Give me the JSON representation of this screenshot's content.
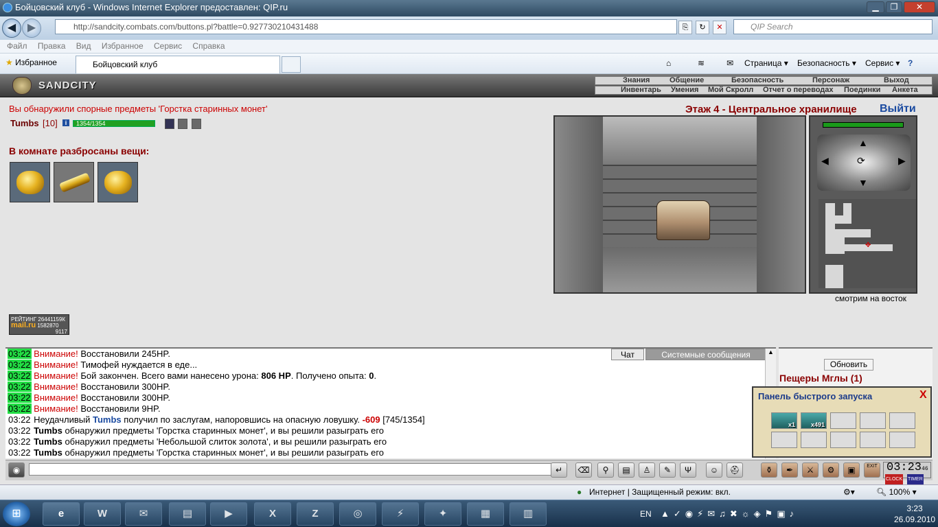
{
  "window": {
    "title": "Бойцовский клуб - Windows Internet Explorer предоставлен: QIP.ru",
    "minimize": "▁",
    "maximize": "❐",
    "close": "✕"
  },
  "address": {
    "url": "http://sandcity.combats.com/buttons.pl?battle=0.927730210431488",
    "search_placeholder": "QIP Search"
  },
  "menu": [
    "Файл",
    "Правка",
    "Вид",
    "Избранное",
    "Сервис",
    "Справка"
  ],
  "favorites": {
    "label": "Избранное",
    "tab_title": "Бойцовский клуб",
    "commands": [
      "Страница ▾",
      "Безопасность ▾",
      "Сервис ▾"
    ]
  },
  "game": {
    "logo": "SANDCITY",
    "top_links": [
      "Знания",
      "Общение",
      "Безопасность",
      "Персонаж",
      "Выход"
    ],
    "sub_links": [
      "Инвентарь",
      "Умения",
      "Мой Скролл",
      "Отчет о переводах",
      "Поединки",
      "Анкета"
    ],
    "notice": "Вы обнаружили спорные предметы 'Горстка старинных монет'",
    "player": {
      "name": "Tumbs",
      "level": "[10]",
      "info": "i",
      "hp_text": "1354/1354",
      "hp_fraction": 1.0
    },
    "room_title": "В комнате разбросаны вещи:",
    "floor_title": "Этаж 4 - Центральное хранилище",
    "exit": "Выйти",
    "facing": "смотрим на восток",
    "rating": {
      "label": "РЕЙТИНГ",
      "value1": "26441159К",
      "mail": "mail.ru",
      "value2": "1582870",
      "value3": "9117"
    }
  },
  "chat": {
    "tabs": [
      "Чат",
      "Системные сообщения"
    ],
    "lines": [
      {
        "time": "03:22",
        "hl": true,
        "warn": "Внимание!",
        "text": "Восстановили 245HP."
      },
      {
        "time": "03:22",
        "hl": true,
        "warn": "Внимание!",
        "text": "Тимофей нуждается в еде..."
      },
      {
        "time": "03:22",
        "hl": true,
        "warn": "Внимание!",
        "text": "Бой закончен. Всего вами нанесено урона:",
        "b1": "806 HP",
        "text2": ". Получено опыта:",
        "b2": "0",
        "text3": "."
      },
      {
        "time": "03:22",
        "hl": true,
        "warn": "Внимание!",
        "text": "Восстановили 300HP."
      },
      {
        "time": "03:22",
        "hl": true,
        "warn": "Внимание!",
        "text": "Восстановили 300HP."
      },
      {
        "time": "03:22",
        "hl": true,
        "warn": "Внимание!",
        "text": "Восстановили 9HP."
      },
      {
        "time": "03:22",
        "hl": false,
        "pre": "Неудачливый",
        "who": "Tumbs",
        "text": "получил по заслугам, напоровшись на опасную ловушку.",
        "dmg": "-609",
        "text2": "[745/1354]"
      },
      {
        "time": "03:22",
        "hl": false,
        "b1": "Tumbs",
        "text": "обнаружил предметы 'Горстка старинных монет', и вы решили разыграть его"
      },
      {
        "time": "03:22",
        "hl": false,
        "b1": "Tumbs",
        "text": "обнаружил предметы 'Небольшой слиток золота', и вы решили разыграть его"
      },
      {
        "time": "03:22",
        "hl": false,
        "b1": "Tumbs",
        "text": "обнаружил предметы 'Горстка старинных монет', и вы решили разыграть его"
      }
    ]
  },
  "right": {
    "refresh": "Обновить",
    "location": "Пещеры Мглы (1)"
  },
  "quick_panel": {
    "title": "Панель быстрого запуска",
    "close": "X",
    "slots": [
      "x1",
      "x491",
      "",
      "",
      "",
      "",
      "",
      "",
      "",
      ""
    ]
  },
  "game_clock": {
    "time": "03:23",
    "seconds": "46",
    "clock_label": "CLOCK",
    "timer_label": "TIMER",
    "exit_label": "EXIT"
  },
  "status": {
    "zone": "Интернет | Защищенный режим: вкл.",
    "zoom": "100%"
  },
  "taskbar": {
    "lang": "EN",
    "time": "3:23",
    "date": "26.09.2010"
  }
}
